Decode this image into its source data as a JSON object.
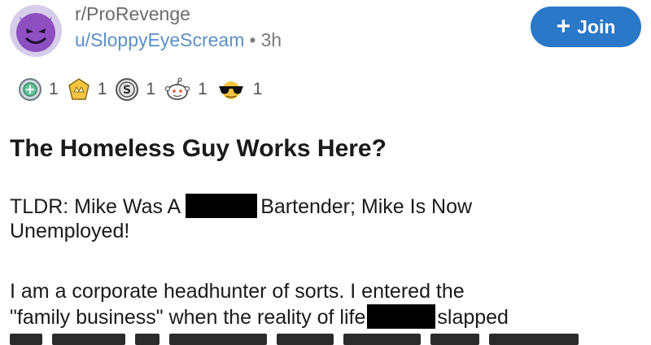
{
  "header": {
    "subreddit": "r/ProRevenge",
    "username": "u/SloppyEyeScream",
    "separator": "•",
    "time": "3h"
  },
  "join_button": {
    "icon": "plus-icon",
    "label": "Join"
  },
  "awards": [
    {
      "icon": "medal-icon",
      "count": "1"
    },
    {
      "icon": "crown-badge-icon",
      "count": "1"
    },
    {
      "icon": "silver-coin-icon",
      "count": "1"
    },
    {
      "icon": "snoo-icon",
      "count": "1"
    },
    {
      "icon": "sunglasses-icon",
      "count": "1"
    }
  ],
  "post": {
    "title": "The Homeless Guy Works Here?",
    "tldr_part1": "TLDR: Mike Was A",
    "tldr_part2": "Bartender; Mike Is Now",
    "tldr_part3": "Unemployed!",
    "body_line1": "I am a corporate headhunter of sorts. I entered the",
    "body_line2a": "\"family business\" when the reality of life",
    "body_line2b": "slapped"
  },
  "colors": {
    "link_blue": "#5b8fc7",
    "join_blue": "#2a78c8",
    "avatar_purple": "#8e4fc1"
  }
}
